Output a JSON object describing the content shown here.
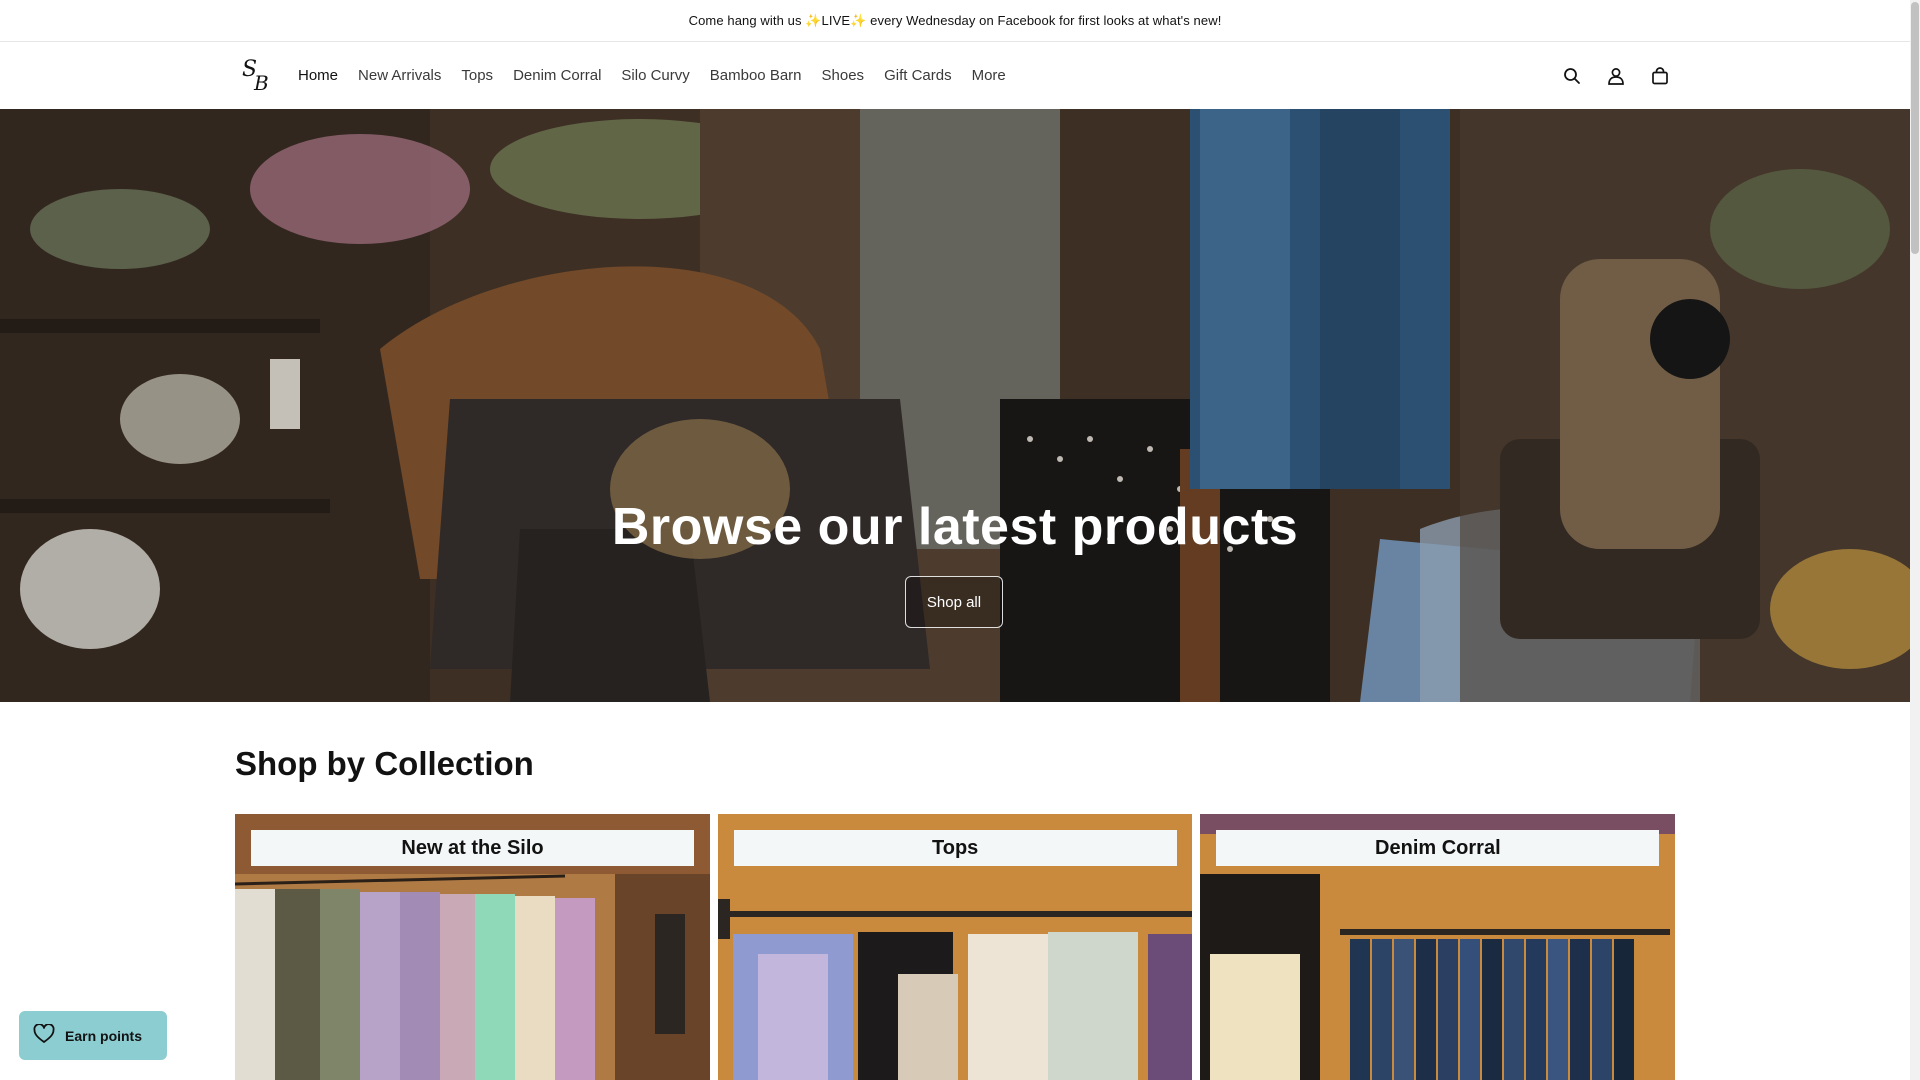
{
  "announcement": {
    "text": "Come hang with us ✨LIVE✨ every Wednesday on Facebook for first looks at what's new!"
  },
  "header": {
    "logo_alt": "S B",
    "nav": [
      "Home",
      "New Arrivals",
      "Tops",
      "Denim Corral",
      "Silo Curvy",
      "Bamboo Barn",
      "Shoes",
      "Gift Cards",
      "More"
    ],
    "icons": [
      "search-icon",
      "account-icon",
      "cart-icon"
    ]
  },
  "hero": {
    "title": "Browse our latest products",
    "button_label": "Shop all"
  },
  "collections": {
    "title": "Shop by Collection",
    "items": [
      {
        "label": "New at the Silo"
      },
      {
        "label": "Tops"
      },
      {
        "label": "Denim Corral"
      }
    ]
  },
  "rewards": {
    "label": "Earn points",
    "icon": "heart-icon"
  },
  "colors": {
    "rewards_bg": "#8ccdd2",
    "label_bg": "#f4f7f8",
    "card_wall": "#c98a3e"
  }
}
